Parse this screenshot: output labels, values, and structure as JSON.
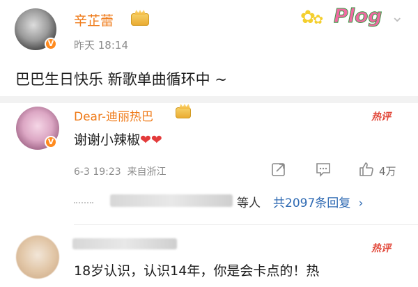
{
  "post": {
    "author_name": "辛芷蕾",
    "time": "昨天 18:14",
    "text": "巴巴生日快乐 新歌单曲循环中 ~",
    "sticker_text": "Plog"
  },
  "comment1": {
    "author_name": "Dear-迪丽热巴",
    "text": "谢谢小辣椒",
    "hearts": "❤❤",
    "hot_label": "热评",
    "meta": "6-3 19:23  来自浙江",
    "like_count": "4万",
    "replies_suffix": "等人",
    "replies_link": "共2097条回复",
    "replies_chevron": "›"
  },
  "comment2": {
    "hot_label": "热评",
    "text": "18岁认识，认识14年，你是会卡点的！热"
  },
  "icons": {
    "v_badge": "V",
    "more": "⌄"
  },
  "colors": {
    "name_orange": "#ef7b1a",
    "hot_red": "#e24a3c",
    "link_blue": "#2f6ab3",
    "badge_orange": "#ff8a1e"
  }
}
